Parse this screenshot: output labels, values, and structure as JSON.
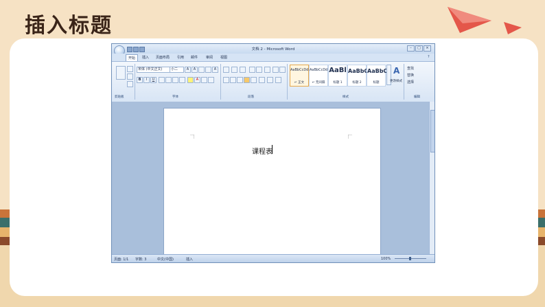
{
  "slide": {
    "title": "插入标题"
  },
  "word": {
    "window_title": "文档 2 - Microsoft Word",
    "tabs": [
      "开始",
      "插入",
      "页面布局",
      "引用",
      "邮件",
      "审阅",
      "视图"
    ],
    "font_name": "宋体 (中文正文)",
    "font_size": "小二",
    "groups": [
      "剪贴板",
      "字体",
      "段落",
      "样式",
      "编辑"
    ],
    "styles": [
      {
        "preview": "AaBbCcDd",
        "name": "↵ 正文"
      },
      {
        "preview": "AaBbCcDd",
        "name": "↵ 无间隔"
      },
      {
        "preview": "AaBl",
        "name": "标题 1"
      },
      {
        "preview": "AaBbC",
        "name": "标题 2"
      },
      {
        "preview": "AaBbC",
        "name": "标题"
      }
    ],
    "change_styles": "更改样式",
    "editing": [
      "查找",
      "替换",
      "选择"
    ],
    "document_text": "课程表",
    "status": {
      "page": "页面: 1/1",
      "words": "字数: 3",
      "language": "中文(中国)",
      "mode": "插入",
      "zoom": "100%"
    }
  }
}
